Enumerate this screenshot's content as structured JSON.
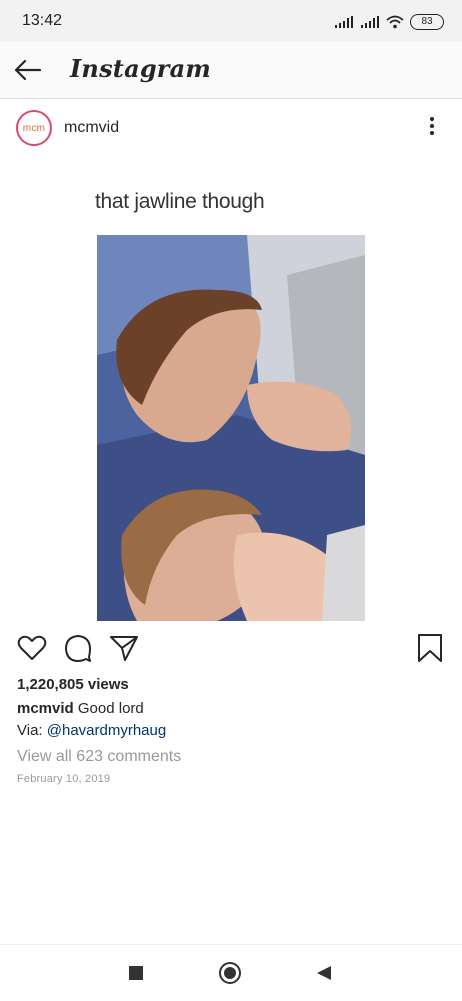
{
  "status": {
    "time": "13:42",
    "battery": "83"
  },
  "header": {
    "brand": "Instagram"
  },
  "post": {
    "avatar_text": "mcm",
    "username": "mcmvid",
    "overlay_text": "that jawline though",
    "views": "1,220,805 views",
    "caption_user": "mcmvid",
    "caption_text": "Good lord",
    "via_prefix": "Via: ",
    "via_mention": "@havardmyrhaug",
    "comments_link": "View all 623 comments",
    "date": "February 10, 2019"
  },
  "colors": {
    "link": "#003569",
    "muted": "#999999",
    "text": "#262626"
  }
}
